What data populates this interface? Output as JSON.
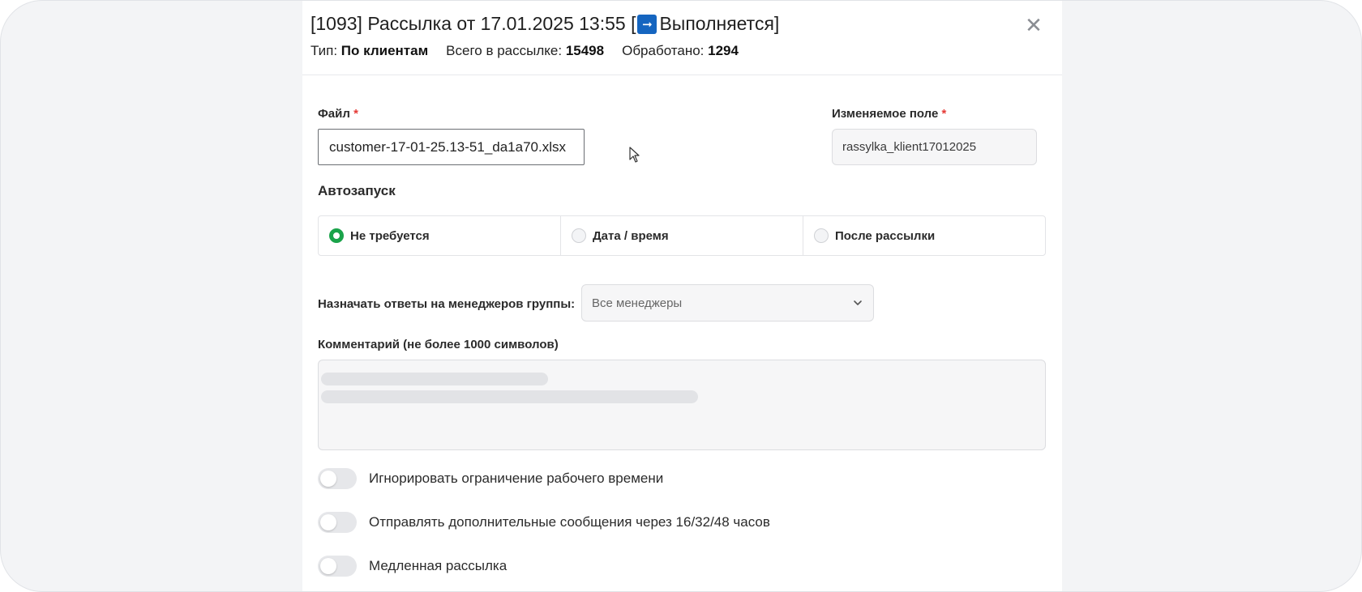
{
  "header": {
    "title_prefix": "[1093] Рассылка от 17.01.2025 13:55 [",
    "status_label": "Выполняется]",
    "status_icon": "right-arrow-icon",
    "status_icon_color": "#1565c0",
    "type_label": "Тип:",
    "type_value": "По клиентам",
    "total_label": "Всего в рассылке:",
    "total_value": "15498",
    "processed_label": "Обработано:",
    "processed_value": "1294",
    "close_icon": "close-icon"
  },
  "form": {
    "file_label": "Файл",
    "file_value": "customer-17-01-25.13-51_da1a70.xlsx",
    "field_label": "Изменяемое поле",
    "field_value": "rassylka_klient17012025",
    "required_mark": "*",
    "autostart_title": "Автозапуск",
    "autostart_options": [
      {
        "label": "Не требуется",
        "checked": true
      },
      {
        "label": "Дата / время",
        "checked": false
      },
      {
        "label": "После рассылки",
        "checked": false
      }
    ],
    "assign_label": "Назначать ответы на менеджеров группы:",
    "assign_value": "Все менеджеры",
    "comment_label": "Комментарий (не более 1000 символов)",
    "toggles": [
      {
        "label": "Игнорировать ограничение рабочего времени",
        "on": false
      },
      {
        "label": "Отправлять дополнительные сообщения через 16/32/48 часов",
        "on": false
      },
      {
        "label": "Медленная рассылка",
        "on": false
      }
    ]
  },
  "colors": {
    "accent_green": "#1aa34a",
    "required_red": "#e53935"
  }
}
